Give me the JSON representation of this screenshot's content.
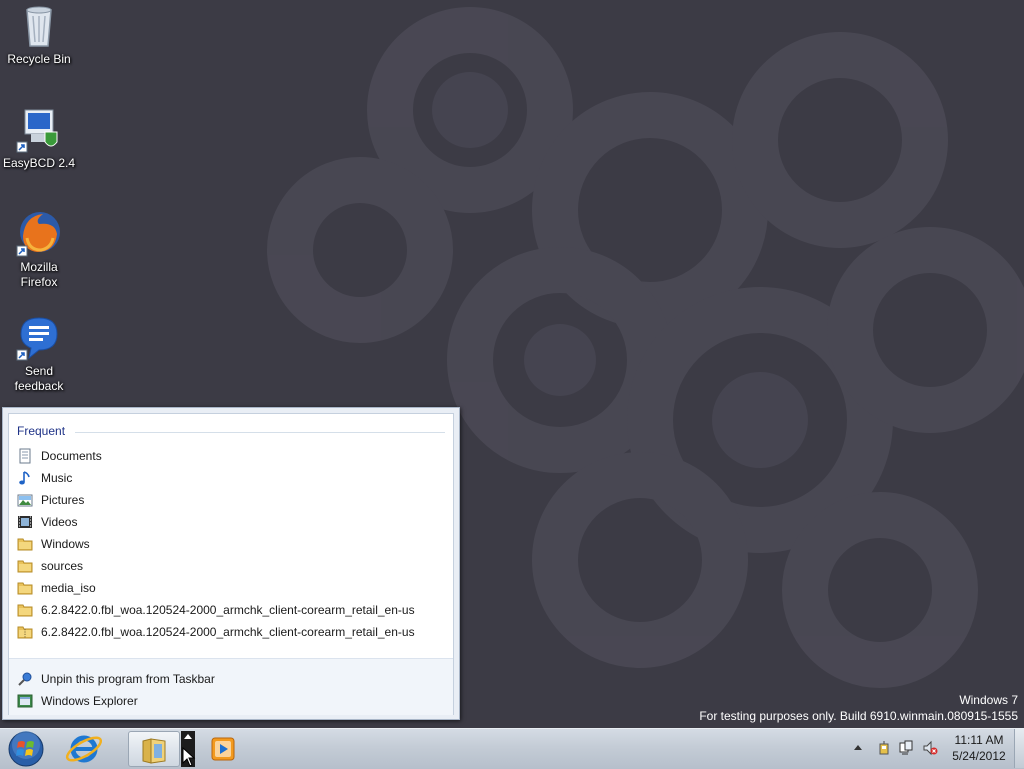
{
  "desktop": {
    "icons": [
      {
        "label_line1": "Recycle Bin",
        "label_line2": "",
        "icon": "recycle-bin-icon"
      },
      {
        "label_line1": "EasyBCD 2.4",
        "label_line2": "",
        "icon": "easybcd-icon"
      },
      {
        "label_line1": "Mozilla",
        "label_line2": "Firefox",
        "icon": "firefox-icon"
      },
      {
        "label_line1": "Send",
        "label_line2": "feedback",
        "icon": "feedback-icon"
      }
    ]
  },
  "jumplist": {
    "heading": "Frequent",
    "items": [
      {
        "label": "Documents",
        "icon": "documents-library-icon"
      },
      {
        "label": "Music",
        "icon": "music-library-icon"
      },
      {
        "label": "Pictures",
        "icon": "pictures-library-icon"
      },
      {
        "label": "Videos",
        "icon": "videos-library-icon"
      },
      {
        "label": "Windows",
        "icon": "folder-icon"
      },
      {
        "label": "sources",
        "icon": "folder-icon"
      },
      {
        "label": "media_iso",
        "icon": "folder-icon"
      },
      {
        "label": "6.2.8422.0.fbl_woa.120524-2000_armchk_client-corearm_retail_en-us",
        "icon": "folder-icon"
      },
      {
        "label": "6.2.8422.0.fbl_woa.120524-2000_armchk_client-corearm_retail_en-us",
        "icon": "zip-folder-icon"
      }
    ],
    "tasks": [
      {
        "label": "Unpin this program from Taskbar",
        "icon": "unpin-icon"
      },
      {
        "label": "Windows Explorer",
        "icon": "windows-explorer-icon"
      }
    ]
  },
  "watermark": {
    "line1": "Windows 7",
    "line2": "For testing purposes only. Build 6910.winmain.080915-1555"
  },
  "taskbar": {
    "pinned": [
      "start-orb-icon",
      "internet-explorer-icon",
      "windows-explorer-icon",
      "media-player-icon"
    ],
    "tray_icons": [
      "action-center-icon",
      "network-icon",
      "volume-muted-icon"
    ]
  },
  "clock": {
    "time": "11:11 AM",
    "date": "5/24/2012"
  }
}
